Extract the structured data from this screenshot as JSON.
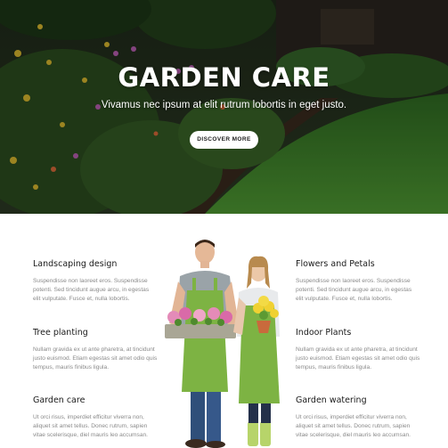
{
  "hero": {
    "title": "GARDEN CARE",
    "subtitle": "Vivamus nec ipsum at elit rutrum lobortis in eget justo.",
    "button_label": "DISCOVER MORE"
  },
  "features": {
    "left": [
      {
        "title": "Landscaping design",
        "text": "Suspendisse non laoreet eros. Suspendisse potenti. Sed tincidunt augue arcu, in egestas elit vulputate. Fusce et, nulla lobortis."
      },
      {
        "title": "Tree planting",
        "text": "Nullam gravida ex ut ante pharetra, at tincidunt justo euismod. Etiam egestas sit amet odio quis tempus, mauris finibus ligula."
      },
      {
        "title": "Garden care",
        "text": "Ut orci risus, imperdiet efficitur viverra non, aliquet sit amet tellus. Donec rutrum, sapien vitae scelerisque, diel mauris leo accumsan."
      }
    ],
    "right": [
      {
        "title": "Flowers and Petals",
        "text": "Suspendisse non laoreet eros. Suspendisse potenti. Sed tincidunt augue arcu, in egestas elit vulputate. Fusce et, nulla lobortis."
      },
      {
        "title": "Indoor Plants",
        "text": "Nullam gravida ex ut ante pharetra, at tincidunt justo euismod. Etiam egestas sit amet odio quis tempus, mauris finibus ligula."
      },
      {
        "title": "Garden watering",
        "text": "Ut orci risus, imperdiet efficitur viverra non, aliquet sit amet tellus. Donec rutrum, sapien vitae scelerisque, diel mauris leo accumsan."
      }
    ]
  },
  "colors": {
    "accent_green": "#7db343",
    "lawn": "#3f7d2c",
    "text_dark": "#1a1a1a",
    "text_muted": "#8a8a8a"
  }
}
